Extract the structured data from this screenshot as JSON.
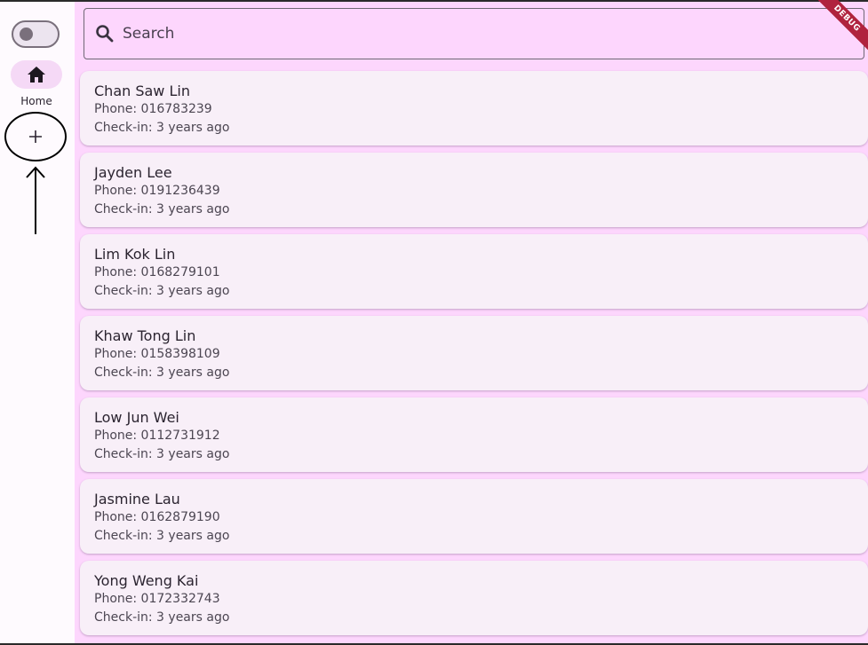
{
  "rail": {
    "home_label": "Home",
    "toggle_state": "off"
  },
  "search": {
    "placeholder": "Search"
  },
  "debug_banner": "DEBUG",
  "contacts": [
    {
      "name": "Chan Saw Lin",
      "phone": "Phone: 016783239",
      "checkin": "Check-in: 3 years ago"
    },
    {
      "name": "Jayden Lee",
      "phone": "Phone: 0191236439",
      "checkin": "Check-in: 3 years ago"
    },
    {
      "name": "Lim Kok Lin",
      "phone": "Phone: 0168279101",
      "checkin": "Check-in: 3 years ago"
    },
    {
      "name": "Khaw Tong Lin",
      "phone": "Phone: 0158398109",
      "checkin": "Check-in: 3 years ago"
    },
    {
      "name": "Low Jun Wei",
      "phone": "Phone: 0112731912",
      "checkin": "Check-in: 3 years ago"
    },
    {
      "name": "Jasmine Lau",
      "phone": "Phone: 0162879190",
      "checkin": "Check-in: 3 years ago"
    },
    {
      "name": "Yong Weng Kai",
      "phone": "Phone: 0172332743",
      "checkin": "Check-in: 3 years ago"
    }
  ],
  "colors": {
    "content_bg": "#fdd6fd",
    "card_bg": "#f8eff8",
    "rail_indicator": "#f5d9f6",
    "debug_ribbon": "#b0233e"
  },
  "icons": [
    "home-icon",
    "add-icon",
    "search-icon",
    "arrow-up-annotation"
  ]
}
